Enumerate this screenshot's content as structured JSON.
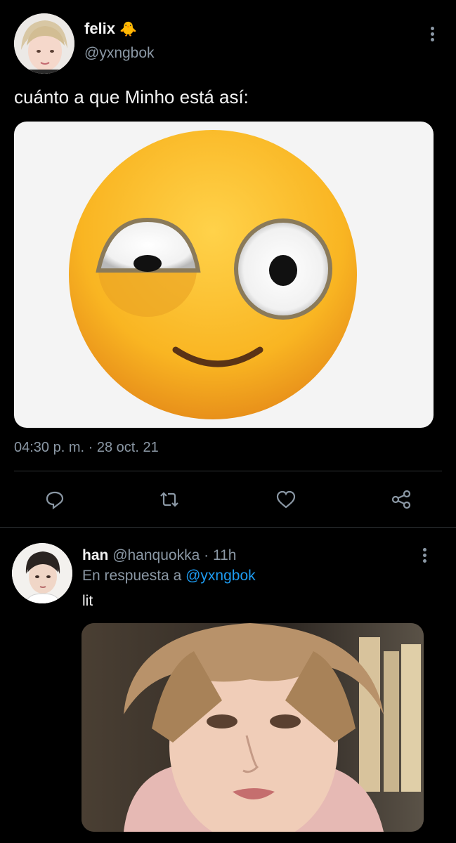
{
  "tweet": {
    "author_name": "felix",
    "author_emoji": "🐥",
    "author_handle": "@yxngbok",
    "text": "cuánto a que Minho está así:",
    "time": "04:30 p. m.",
    "separator": "·",
    "date": "28 oct. 21",
    "media_icon": "flushed-emoji-image",
    "actions": [
      "reply-icon",
      "retweet-icon",
      "like-icon",
      "share-icon"
    ]
  },
  "reply": {
    "author_name": "han",
    "author_handle": "@hanquokka",
    "separator": "·",
    "age": "11h",
    "in_reply_prefix": "En respuesta a",
    "in_reply_handle": "@yxngbok",
    "text": "lit",
    "media_icon": "person-photo"
  },
  "colors": {
    "background": "#000000",
    "text": "#f2f2f2",
    "secondary": "#8b98a5",
    "link": "#1d9bf0",
    "divider": "#2f3336"
  }
}
